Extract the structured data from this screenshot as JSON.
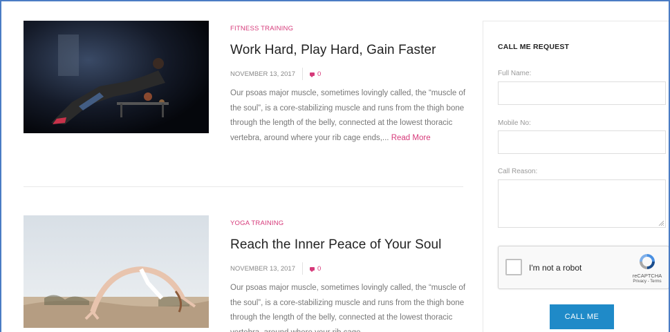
{
  "posts": [
    {
      "category": "FITNESS TRAINING",
      "title": "Work Hard, Play Hard, Gain Faster",
      "date": "NOVEMBER 13, 2017",
      "comments": "0",
      "excerpt": "Our psoas major muscle, sometimes lovingly called, the “muscle of the soul”, is a core-stabilizing muscle and runs from the thigh bone through the length of the belly, connected at the lowest thoracic vertebra, around where your rib cage ends,...",
      "read_more": "Read More"
    },
    {
      "category": "YOGA TRAINING",
      "title": "Reach the Inner Peace of Your Soul",
      "date": "NOVEMBER 13, 2017",
      "comments": "0",
      "excerpt": "Our psoas major muscle, sometimes lovingly called, the “muscle of the soul”, is a core-stabilizing muscle and runs from the thigh bone through the length of the belly, connected at the lowest thoracic vertebra, around where your rib cage",
      "read_more": ""
    }
  ],
  "sidebar": {
    "title": "CALL ME REQUEST",
    "full_name_label": "Full Name:",
    "mobile_label": "Mobile No:",
    "reason_label": "Call Reason:",
    "recaptcha_label": "I'm not a robot",
    "recaptcha_brand": "reCAPTCHA",
    "recaptcha_terms": "Privacy - Terms",
    "button_label": "CALL ME"
  },
  "colors": {
    "accent": "#d63a7a",
    "button": "#1f8ac8",
    "frame": "#4a7cc4"
  }
}
